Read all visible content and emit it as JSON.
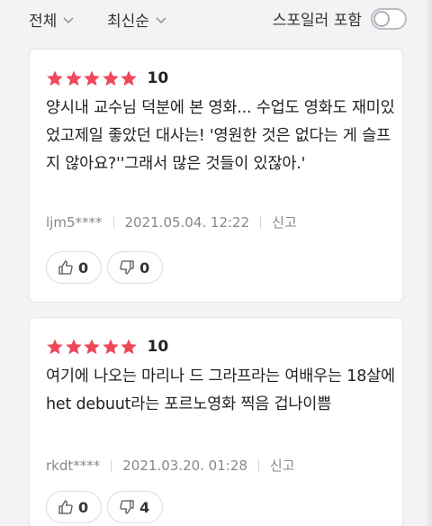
{
  "filters": {
    "overall": "전체",
    "sort": "최신순",
    "spoiler_label": "스포일러 포함",
    "spoiler_enabled": false
  },
  "reviews": [
    {
      "stars": 5,
      "score": "10",
      "text": "양시내 교수님 덕분에 본 영화... 수업도 영화도 재미있었고제일 좋았던 대사는! '영원한 것은 없다는 게 슬프지 않아요?''그래서 많은 것들이 있잖아.'",
      "user": "ljm5****",
      "date": "2021.05.04. 12:22",
      "report_label": "신고",
      "likes": "0",
      "dislikes": "0"
    },
    {
      "stars": 5,
      "score": "10",
      "text": "여기에 나오는 마리나 드 그라프라는 여배우는 18살에 het debuut라는 포르노영화 찍음 겁나이쁨",
      "user": "rkdt****",
      "date": "2021.03.20. 01:28",
      "report_label": "신고",
      "likes": "0",
      "dislikes": "4"
    }
  ],
  "colors": {
    "star": "#f0485a",
    "background": "#f3f3f5",
    "card": "#ffffff"
  }
}
